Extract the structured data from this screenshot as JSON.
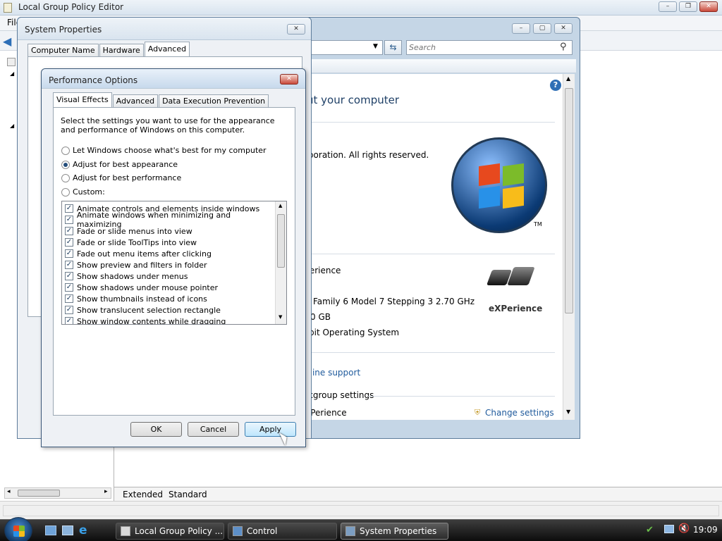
{
  "gpedit": {
    "title": "Local Group Policy Editor",
    "menu_first": "File",
    "tabs": [
      "Extended",
      "Standard"
    ]
  },
  "control_panel": {
    "search_placeholder": "Search",
    "heading_fragment": "ut your computer",
    "copyright_fragment": "rporation.  All rights reserved.",
    "edition_fragment": "Perience",
    "processor_fragment": "Family 6 Model 7 Stepping 3   2.70 GHz",
    "memory_fragment": "0 GB",
    "systype_fragment": "bit Operating System",
    "support_fragment": "nline support",
    "workgroup_fragment": "rkgroup settings",
    "name_fragment": "XPerience",
    "change_settings": "Change settings",
    "oem_logo_text": "eXPerience"
  },
  "sysprops": {
    "title": "System Properties",
    "tabs": [
      "Computer Name",
      "Hardware",
      "Advanced"
    ]
  },
  "perf": {
    "title": "Performance Options",
    "tabs": [
      "Visual Effects",
      "Advanced",
      "Data Execution Prevention"
    ],
    "description": "Select the settings you want to use for the appearance and performance of Windows on this computer.",
    "options": [
      {
        "label": "Let Windows choose what's best for my computer",
        "selected": false
      },
      {
        "label": "Adjust for best appearance",
        "selected": true
      },
      {
        "label": "Adjust for best performance",
        "selected": false
      },
      {
        "label": "Custom:",
        "selected": false
      }
    ],
    "effects": [
      "Animate controls and elements inside windows",
      "Animate windows when minimizing and maximizing",
      "Fade or slide menus into view",
      "Fade or slide ToolTips into view",
      "Fade out menu items after clicking",
      "Show preview and filters in folder",
      "Show shadows under menus",
      "Show shadows under mouse pointer",
      "Show thumbnails instead of icons",
      "Show translucent selection rectangle",
      "Show window contents while dragging"
    ],
    "buttons": {
      "ok": "OK",
      "cancel": "Cancel",
      "apply": "Apply"
    }
  },
  "taskbar": {
    "items": [
      "Local Group Policy ...",
      "Control Panel\\System",
      "System Properties"
    ],
    "clock": "19:09"
  },
  "colors": {
    "accent": "#3c7fb1",
    "link": "#1f5a9c",
    "close": "#c9493a"
  }
}
